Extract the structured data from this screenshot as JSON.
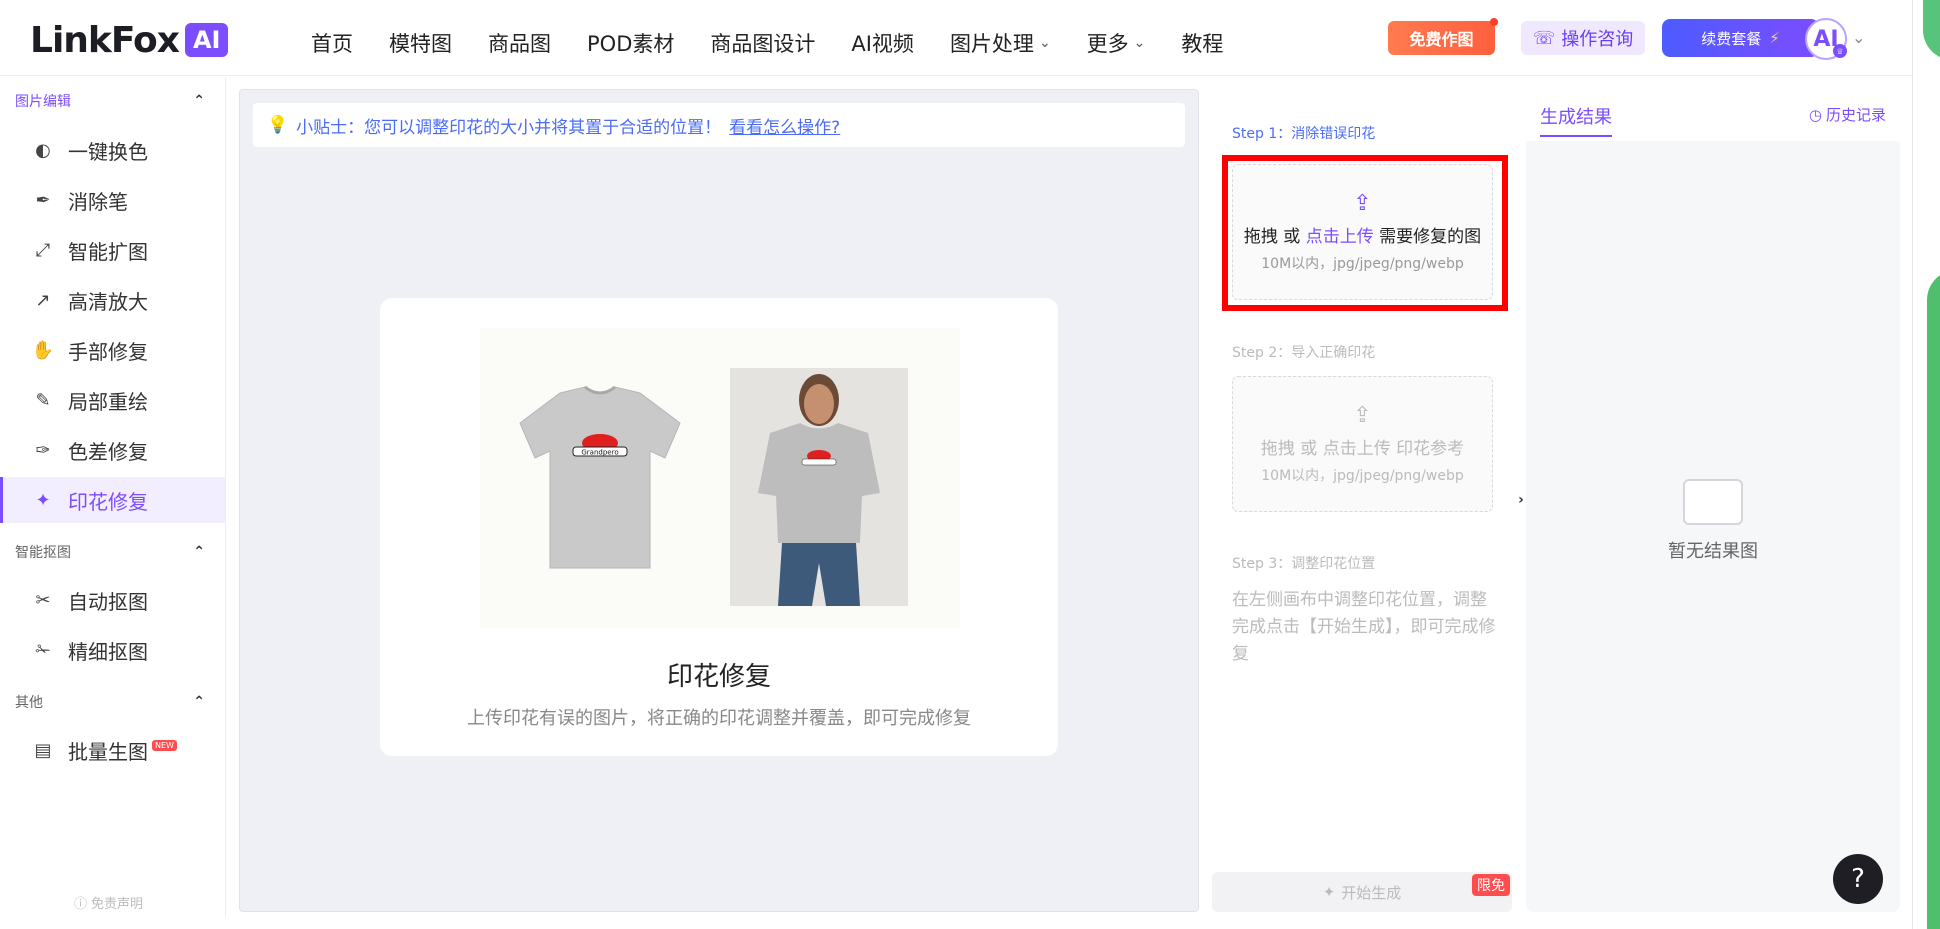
{
  "header": {
    "logo_text": "LinkFox",
    "logo_badge": "AI",
    "nav": [
      {
        "label": "首页",
        "has_menu": false
      },
      {
        "label": "模特图",
        "has_menu": false
      },
      {
        "label": "商品图",
        "has_menu": false
      },
      {
        "label": "POD素材",
        "has_menu": false
      },
      {
        "label": "商品图设计",
        "has_menu": false
      },
      {
        "label": "AI视频",
        "has_menu": false
      },
      {
        "label": "图片处理",
        "has_menu": true
      },
      {
        "label": "更多",
        "has_menu": true
      },
      {
        "label": "教程",
        "has_menu": false
      }
    ],
    "free_button": "免费作图",
    "consult_button": "操作咨询",
    "renew_button": "续费套餐",
    "avatar_text": "AI"
  },
  "sidebar": {
    "groups": [
      {
        "title": "图片编辑",
        "items": [
          "一键换色",
          "消除笔",
          "智能扩图",
          "高清放大",
          "手部修复",
          "局部重绘",
          "色差修复",
          "印花修复"
        ]
      },
      {
        "title": "智能抠图",
        "items": [
          "自动抠图",
          "精细抠图"
        ]
      },
      {
        "title": "其他",
        "items": [
          "批量生图"
        ]
      }
    ],
    "active_item": "印花修复",
    "new_badge": "NEW",
    "disclaimer": "免责声明"
  },
  "canvas": {
    "tip_prefix": "小贴士：您可以调整印花的大小并将其置于合适的位置！",
    "tip_link": "看看怎么操作?",
    "card_title": "印花修复",
    "card_subtitle": "上传印花有误的图片，将正确的印花调整并覆盖，即可完成修复",
    "print_text": "Grandpero"
  },
  "steps": {
    "step1_label": "Step 1：消除错误印花",
    "step1_upload_pre": "拖拽 或 ",
    "step1_upload_link": "点击上传",
    "step1_upload_post": " 需要修复的图",
    "step1_hint": "10M以内，jpg/jpeg/png/webp",
    "step2_label": "Step 2：导入正确印花",
    "step2_upload": "拖拽 或 点击上传 印花参考",
    "step2_hint": "10M以内，jpg/jpeg/png/webp",
    "step3_label": "Step 3：调整印花位置",
    "step3_text": "在左侧画布中调整印花位置，调整完成点击【开始生成】，即可完成修复",
    "start_button": "开始生成",
    "limited_badge": "限免"
  },
  "results": {
    "tab": "生成结果",
    "history": "历史记录",
    "empty_text": "暂无结果图"
  },
  "help_label": "?",
  "colors": {
    "accent": "#7b4dff",
    "link": "#4a6cf7",
    "highlight": "#ff0000"
  }
}
